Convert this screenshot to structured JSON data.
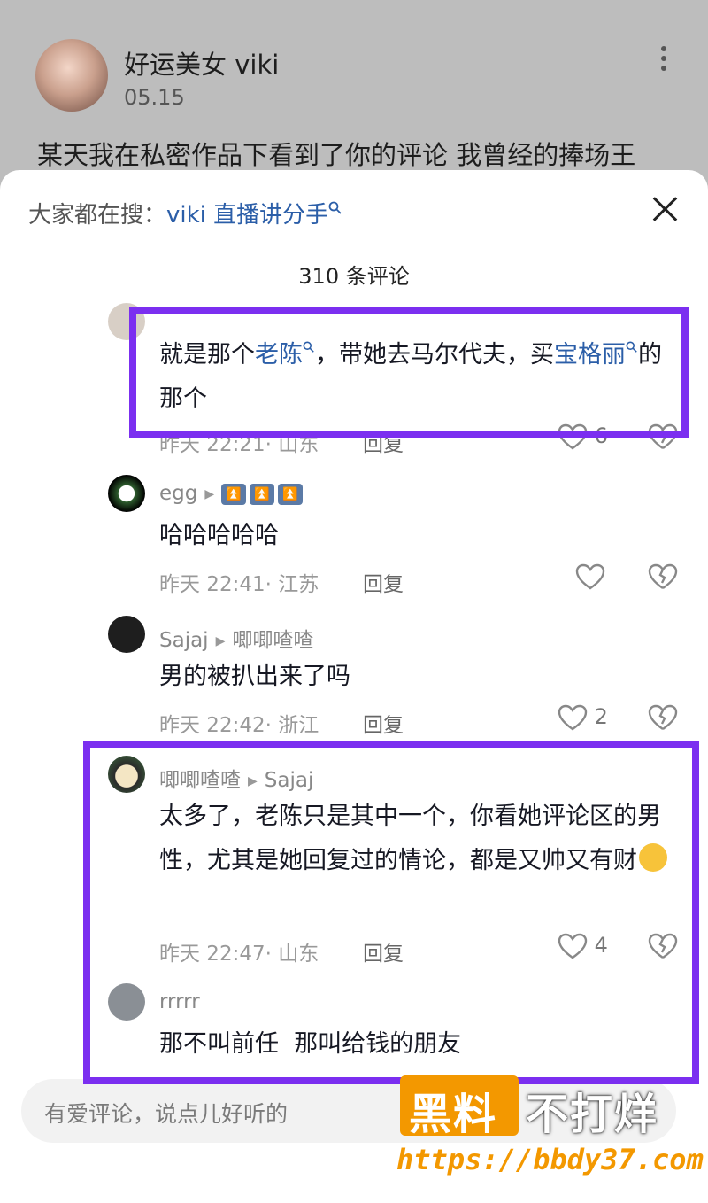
{
  "post": {
    "username": "好运美女 viki",
    "date": "05.15",
    "text": "某天我在私密作品下看到了你的评论 我曾经的捧场王"
  },
  "sheet": {
    "search_prefix": "大家都在搜：",
    "search_keyword": "viki 直播讲分手",
    "count_label": "310 条评论",
    "input_placeholder": "有爱评论，说点儿好听的"
  },
  "comments": [
    {
      "text_a": "就是那个",
      "link_a": "老陈",
      "text_b": "，带她去马尔代夫，买",
      "link_b": "宝格丽",
      "text_c": "的那个",
      "meta": "昨天 22:21· 山东",
      "reply": "回复",
      "likes": "6"
    },
    {
      "name": "egg",
      "text": "哈哈哈哈哈",
      "meta": "昨天 22:41· 江苏",
      "reply": "回复",
      "likes": ""
    },
    {
      "name": "Sajaj",
      "reply_to": "唧唧喳喳",
      "text": "男的被扒出来了吗",
      "meta": "昨天 22:42· 浙江",
      "reply": "回复",
      "likes": "2"
    },
    {
      "name": "唧唧喳喳",
      "reply_to": "Sajaj",
      "text": "太多了，老陈只是其中一个，你看她评论区的男性，尤其是她回复过的情论，都是又帅又有财",
      "meta": "昨天 22:47· 山东",
      "reply": "回复",
      "likes": "4"
    },
    {
      "name": "rrrrr",
      "text": "那不叫前任  那叫给钱的朋友"
    }
  ],
  "watermark": {
    "text_orange": "黑料",
    "text_white": "不打烊",
    "url": "https://bbdy37.com"
  },
  "colors": {
    "highlight": "#7b2ff0",
    "link": "#2b5ea8",
    "watermark": "#f39800"
  }
}
